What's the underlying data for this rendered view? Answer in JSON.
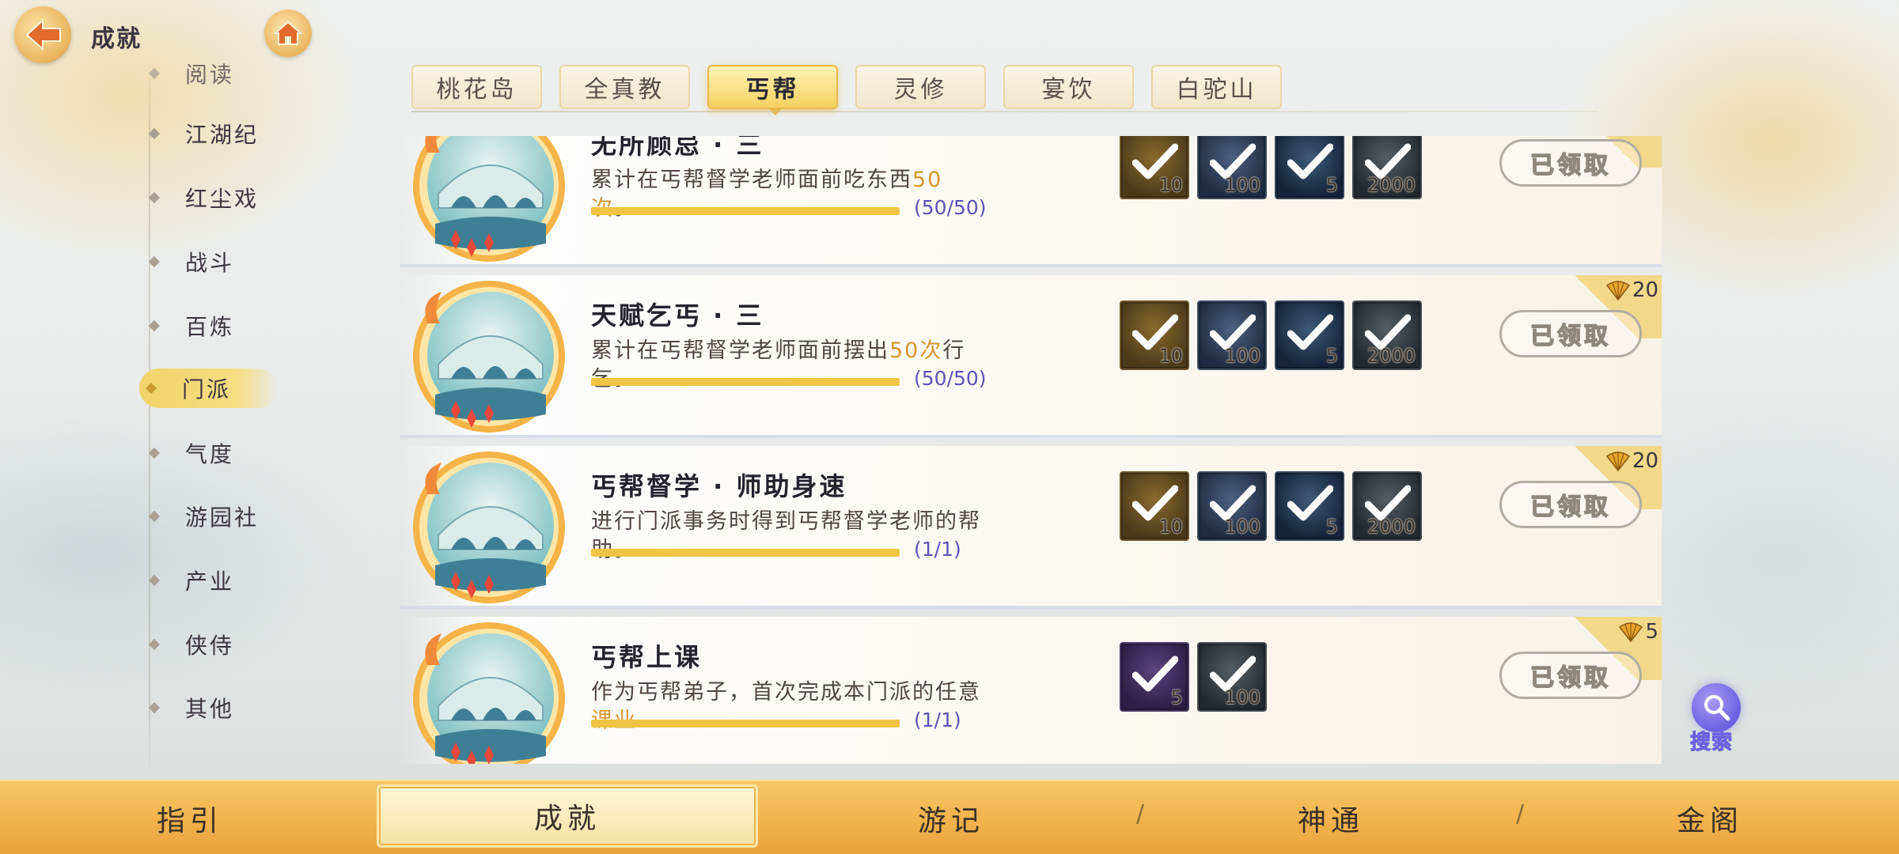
{
  "header": {
    "title": "成就"
  },
  "sidebar": {
    "items": [
      {
        "label": "阅读"
      },
      {
        "label": "江湖纪"
      },
      {
        "label": "红尘戏"
      },
      {
        "label": "战斗"
      },
      {
        "label": "百炼"
      },
      {
        "label": "门派"
      },
      {
        "label": "气度"
      },
      {
        "label": "游园社"
      },
      {
        "label": "产业"
      },
      {
        "label": "侠侍"
      },
      {
        "label": "其他"
      }
    ],
    "active": "门派"
  },
  "tabs": {
    "items": [
      {
        "label": "桃花岛"
      },
      {
        "label": "全真教"
      },
      {
        "label": "丐帮"
      },
      {
        "label": "灵修"
      },
      {
        "label": "宴饮"
      },
      {
        "label": "白驼山"
      }
    ],
    "active": "丐帮"
  },
  "achievements": [
    {
      "title": "无所顾忌 · 三",
      "desc_pre": "累计在丐帮督学老师面前吃东西",
      "desc_hl": "50次",
      "desc_post": "。",
      "progress_text": "(50/50)",
      "progress_fraction": 1.0,
      "points": "",
      "rewards": [
        {
          "qty": "10"
        },
        {
          "qty": "100"
        },
        {
          "qty": "5"
        },
        {
          "qty": "2000"
        }
      ],
      "status": "已领取"
    },
    {
      "title": "天赋乞丐 · 三",
      "desc_pre": "累计在丐帮督学老师面前摆出",
      "desc_hl": "50次",
      "desc_post": "行乞。",
      "progress_text": "(50/50)",
      "progress_fraction": 1.0,
      "points": "20",
      "rewards": [
        {
          "qty": "10"
        },
        {
          "qty": "100"
        },
        {
          "qty": "5"
        },
        {
          "qty": "2000"
        }
      ],
      "status": "已领取"
    },
    {
      "title": "丐帮督学 · 师助身速",
      "desc_pre": "进行门派事务时得到丐帮督学老师的帮助。",
      "desc_hl": "",
      "desc_post": "",
      "progress_text": "(1/1)",
      "progress_fraction": 1.0,
      "points": "20",
      "rewards": [
        {
          "qty": "10"
        },
        {
          "qty": "100"
        },
        {
          "qty": "5"
        },
        {
          "qty": "2000"
        }
      ],
      "status": "已领取"
    },
    {
      "title": "丐帮上课",
      "desc_pre": "作为丐帮弟子，首次完成本门派的任意",
      "desc_hl": "课业",
      "desc_post": "",
      "progress_text": "(1/1)",
      "progress_fraction": 1.0,
      "points": "5",
      "rewards": [
        {
          "qty": "5"
        },
        {
          "qty": "100"
        }
      ],
      "status": "已领取"
    }
  ],
  "search": {
    "label": "搜索"
  },
  "bottom_nav": {
    "items": [
      {
        "label": "指引"
      },
      {
        "label": "成就"
      },
      {
        "label": "游记"
      },
      {
        "label": "神通"
      },
      {
        "label": "金阁"
      }
    ],
    "separator": "/",
    "active": "成就"
  },
  "colors": {
    "accent_gold": "#f0c543",
    "progress_text": "#5b52b8",
    "highlight": "#d8962b",
    "nav_bar": "#f2b24c"
  }
}
